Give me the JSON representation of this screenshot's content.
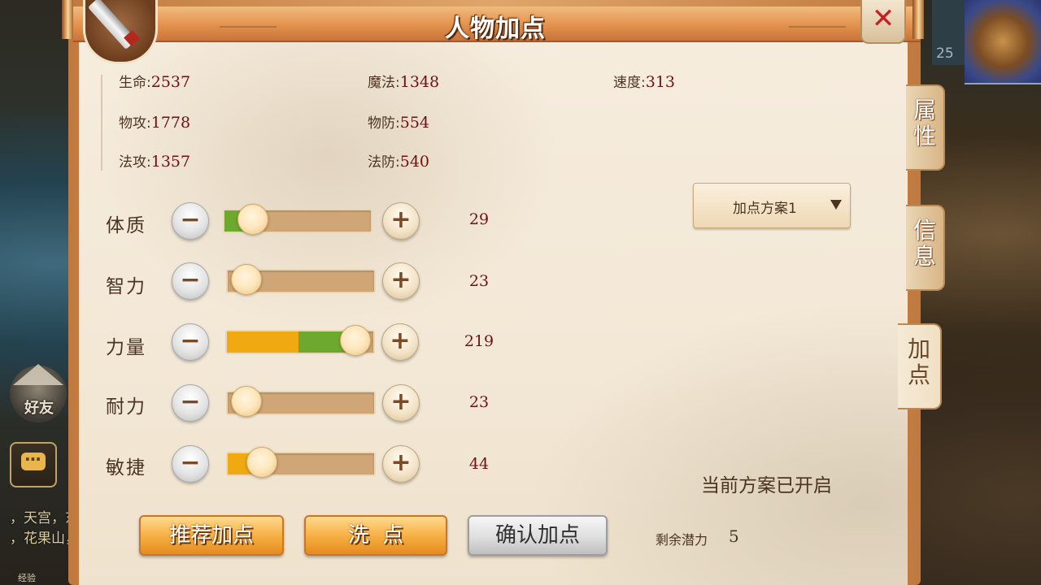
{
  "window": {
    "title": "人物加点",
    "close_icon": "✕"
  },
  "hud": {
    "friend_label": "好友",
    "chat_lines": [
      "，天宫，东",
      "，花果山，"
    ],
    "exp_label": "经验",
    "level": "25"
  },
  "stats": {
    "hp": {
      "label": "生命:",
      "value": "2537"
    },
    "mp": {
      "label": "魔法:",
      "value": "1348"
    },
    "speed": {
      "label": "速度:",
      "value": "313"
    },
    "patk": {
      "label": "物攻:",
      "value": "1778"
    },
    "pdef": {
      "label": "物防:",
      "value": "554"
    },
    "matk": {
      "label": "法攻:",
      "value": "1357"
    },
    "mdef": {
      "label": "法防:",
      "value": "540"
    }
  },
  "attributes": [
    {
      "label": "体质",
      "value": "29",
      "fill_orange": 0.0,
      "fill_green": 0.17,
      "knob": 0.19
    },
    {
      "label": "智力",
      "value": "23",
      "fill_orange": 0.0,
      "fill_green": 0.0,
      "knob": 0.12
    },
    {
      "label": "力量",
      "value": "219",
      "fill_orange": 0.49,
      "fill_green": 0.87,
      "knob": 0.87
    },
    {
      "label": "耐力",
      "value": "23",
      "fill_orange": 0.0,
      "fill_green": 0.0,
      "knob": 0.12
    },
    {
      "label": "敏捷",
      "value": "44",
      "fill_orange": 0.23,
      "fill_green": 0.0,
      "knob": 0.23
    }
  ],
  "buttons": {
    "minus": "−",
    "plus": "+"
  },
  "plan": {
    "selected": "加点方案1",
    "status": "当前方案已开启"
  },
  "side_tabs": {
    "attributes": "属性",
    "info": "信息",
    "add_points": "加点"
  },
  "remaining": {
    "label": "剩余潜力",
    "value": "5"
  },
  "actions": {
    "recommend": "推荐加点",
    "reset": "洗  点",
    "confirm": "确认加点"
  },
  "colors": {
    "bar_orange": "#f0a911",
    "bar_green": "#6da92f",
    "value_red": "#6d1212"
  }
}
